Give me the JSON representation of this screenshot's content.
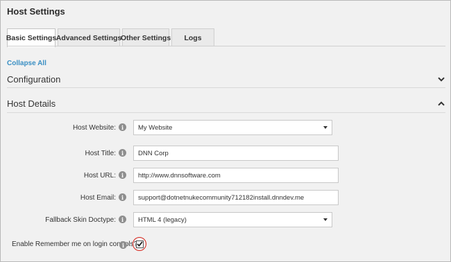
{
  "page": {
    "title": "Host Settings"
  },
  "tabs": [
    {
      "label": "Basic Settings"
    },
    {
      "label": "Advanced Settings"
    },
    {
      "label": "Other Settings"
    },
    {
      "label": "Logs"
    }
  ],
  "collapse_all": "Collapse All",
  "sections": {
    "configuration": "Configuration",
    "host_details": "Host Details"
  },
  "fields": {
    "host_website": {
      "label": "Host Website:",
      "value": "My Website"
    },
    "host_title": {
      "label": "Host Title:",
      "value": "DNN Corp"
    },
    "host_url": {
      "label": "Host URL:",
      "value": "http://www.dnnsoftware.com"
    },
    "host_email": {
      "label": "Host Email:",
      "value": "support@dotnetnukecommunity712182install.dnndev.me"
    },
    "fallback_doctype": {
      "label": "Fallback Skin Doctype:",
      "value": "HTML 4 (legacy)"
    },
    "remember_me": {
      "label": "Enable Remember me on login controls?",
      "checked": true
    }
  },
  "colors": {
    "link": "#3a8fc3",
    "highlight_ring": "#d8231a"
  },
  "icons": {
    "info": "info-icon",
    "expand": "chevron-down-icon",
    "collapse": "chevron-up-icon",
    "check": "check-icon"
  }
}
